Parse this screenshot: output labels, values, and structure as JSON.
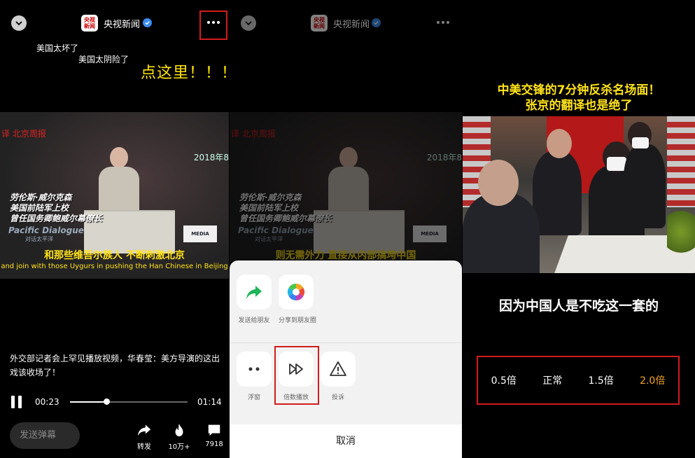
{
  "panel1": {
    "header": {
      "channel": "央视新闻",
      "logo_line1": "央视",
      "logo_line2": "新闻"
    },
    "danmu": [
      "美国太坏了",
      "美国太阴险了"
    ],
    "callout": "点这里！！！",
    "video": {
      "top_left": "译 北京周报",
      "date": "2018年8",
      "bio_lines": [
        "劳伦斯·威尔克森",
        "美国前陆军上校",
        "曾任国务卿鲍威尔幕僚长"
      ],
      "pacific": "Pacific Dialogue",
      "pacific_cn": "对话太平洋",
      "media_sign": "MEDIA",
      "subtitle_cn": "和那些维吾尔族人 不断刺激北京",
      "subtitle_en": "and join with those Uygurs in pushing the Han Chinese in Beijing"
    },
    "description": "外交部记者会上罕见播放视频，华春莹：美方导演的这出戏该收场了！",
    "player": {
      "current": "00:23",
      "total": "01:14",
      "progress": 0.31
    },
    "danmu_placeholder": "发送弹幕",
    "actions": [
      {
        "icon": "share-arrow-icon",
        "label": "转发"
      },
      {
        "icon": "flame-icon",
        "label": "10万+"
      },
      {
        "icon": "comment-icon",
        "label": "7918"
      }
    ]
  },
  "panel2": {
    "header": {
      "channel": "央视新闻",
      "logo_line1": "央视",
      "logo_line2": "新闻"
    },
    "video": {
      "top_left": "译 北京周报",
      "date": "2018年8",
      "bio_lines": [
        "劳伦斯·威尔克森",
        "美国前陆军上校",
        "曾任国务卿鲍威尔幕僚长"
      ],
      "pacific": "Pacific Dialogue",
      "pacific_cn": "对话太平洋",
      "media_sign": "MEDIA",
      "subtitle_cn": "则无需外力 直接从内部搞垮中国"
    },
    "sheet": {
      "row1": [
        {
          "icon": "share-green-arrow-icon",
          "label": "发送给朋友"
        },
        {
          "icon": "moments-icon",
          "label": "分享到朋友圈"
        }
      ],
      "row2": [
        {
          "icon": "float-window-icon",
          "label": "浮窗"
        },
        {
          "icon": "speed-play-icon",
          "label": "倍数播放"
        },
        {
          "icon": "report-icon",
          "label": "投诉"
        }
      ],
      "cancel": "取消"
    }
  },
  "panel3": {
    "title_line1": "中美交锋的7分钟反杀名场面！",
    "title_line2": "张京的翻译也是绝了",
    "subtitle": "因为中国人是不吃这一套的",
    "speeds": [
      {
        "label": "0.5倍",
        "active": false
      },
      {
        "label": "正常",
        "active": false
      },
      {
        "label": "1.5倍",
        "active": false
      },
      {
        "label": "2.0倍",
        "active": true
      }
    ],
    "active_color": "#f5a623"
  },
  "colors": {
    "highlight_box": "#d21c1c",
    "subtitle_yellow": "#ffe21a",
    "callout_yellow": "#ffe400"
  }
}
